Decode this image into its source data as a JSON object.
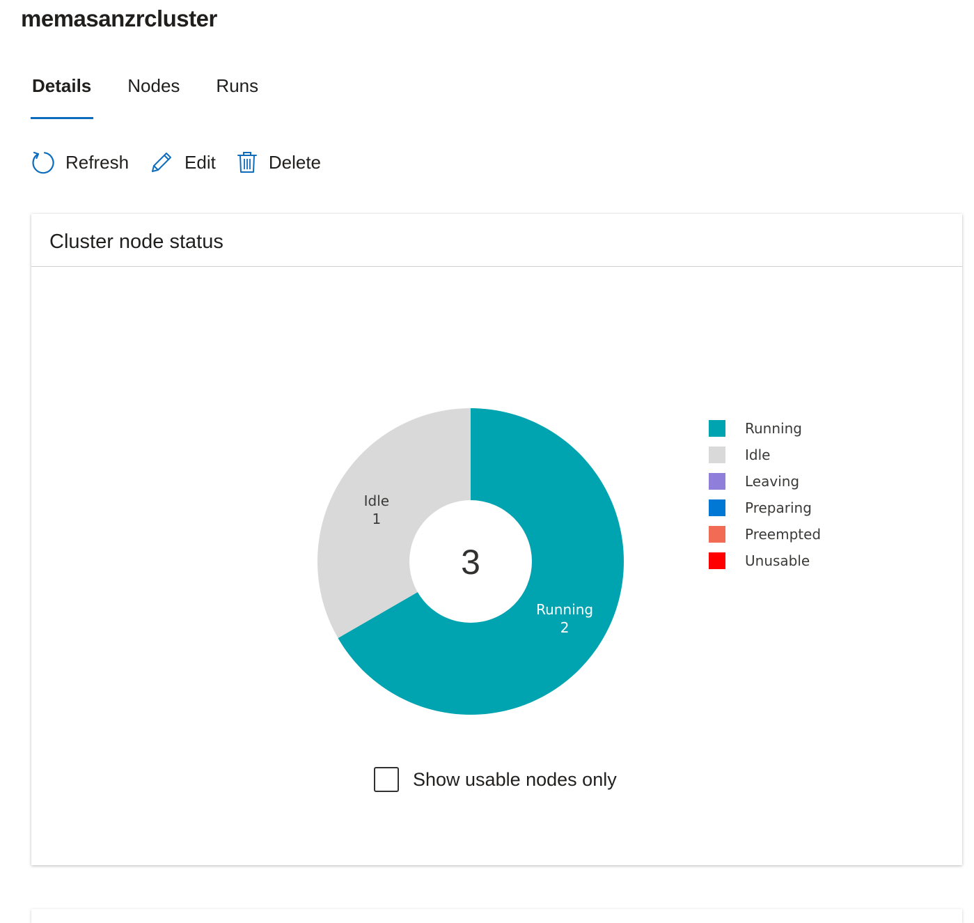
{
  "page": {
    "title": "memasanzrcluster"
  },
  "tabs": [
    {
      "label": "Details",
      "active": true
    },
    {
      "label": "Nodes",
      "active": false
    },
    {
      "label": "Runs",
      "active": false
    }
  ],
  "toolbar": {
    "refresh_label": "Refresh",
    "refresh_icon": "refresh-icon",
    "edit_label": "Edit",
    "edit_icon": "pencil-icon",
    "delete_label": "Delete",
    "delete_icon": "trash-icon",
    "icon_color": "#0f6cbd"
  },
  "card": {
    "title": "Cluster node status"
  },
  "chart_data": {
    "type": "pie",
    "donut": true,
    "center_label": "3",
    "legend_position": "right",
    "slices": [
      {
        "label": "Running",
        "value": 2,
        "color": "#00a4b0",
        "label_color": "#ffffff"
      },
      {
        "label": "Idle",
        "value": 1,
        "color": "#d9d9d9",
        "label_color": "#3b3a39"
      }
    ],
    "legend": [
      {
        "label": "Running",
        "color": "#00a4b0"
      },
      {
        "label": "Idle",
        "color": "#d9d9d9"
      },
      {
        "label": "Leaving",
        "color": "#8f7fdb"
      },
      {
        "label": "Preparing",
        "color": "#0078d4"
      },
      {
        "label": "Preempted",
        "color": "#f26b54"
      },
      {
        "label": "Unusable",
        "color": "#ff0000"
      }
    ]
  },
  "filter": {
    "show_usable_label": "Show usable nodes only",
    "checked": false
  }
}
